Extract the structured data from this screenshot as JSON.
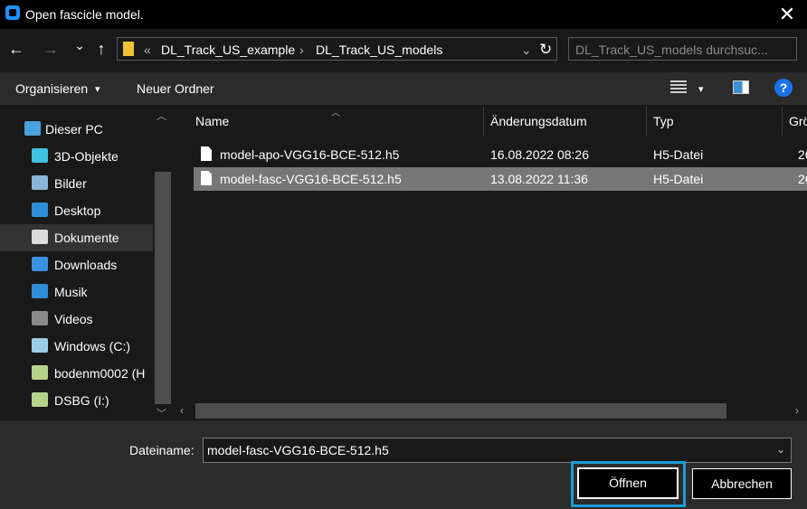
{
  "window": {
    "title": "Open fascicle model.",
    "close_glyph": "✕"
  },
  "nav": {
    "back_glyph": "←",
    "forward_glyph": "→",
    "recent_glyph": "⌄",
    "up_glyph": "↑",
    "breadcrumb_overflow": "«",
    "breadcrumb": [
      "DL_Track_US_example",
      "DL_Track_US_models"
    ],
    "separator": "›",
    "refresh_glyph": "↻",
    "search_placeholder": "DL_Track_US_models durchsuc..."
  },
  "toolbar": {
    "organize_label": "Organisieren",
    "organize_caret": "▾",
    "new_folder_label": "Neuer Ordner",
    "help_glyph": "?"
  },
  "sidebar": {
    "items": [
      {
        "label": "Dieser PC",
        "icon": "pc-icon"
      },
      {
        "label": "3D-Objekte",
        "icon": "cube-icon"
      },
      {
        "label": "Bilder",
        "icon": "pictures-icon"
      },
      {
        "label": "Desktop",
        "icon": "desktop-icon"
      },
      {
        "label": "Dokumente",
        "icon": "documents-icon"
      },
      {
        "label": "Downloads",
        "icon": "download-icon"
      },
      {
        "label": "Musik",
        "icon": "music-icon"
      },
      {
        "label": "Videos",
        "icon": "videos-icon"
      },
      {
        "label": "Windows (C:)",
        "icon": "drive-icon"
      },
      {
        "label": "bodenm0002 (H",
        "icon": "network-drive-icon"
      },
      {
        "label": "DSBG (I:)",
        "icon": "network-drive-icon"
      }
    ],
    "selected_index": 4
  },
  "list": {
    "columns": [
      "Name",
      "Änderungsdatum",
      "Typ",
      "Grö"
    ],
    "rows": [
      {
        "name": "model-apo-VGG16-BCE-512.h5",
        "date": "16.08.2022 08:26",
        "type": "H5-Datei",
        "size": "26"
      },
      {
        "name": "model-fasc-VGG16-BCE-512.h5",
        "date": "13.08.2022 11:36",
        "type": "H5-Datei",
        "size": "26"
      }
    ],
    "selected_index": 1
  },
  "footer": {
    "filename_label": "Dateiname:",
    "filename_value": "model-fasc-VGG16-BCE-512.h5",
    "open_label": "Öffnen",
    "cancel_label": "Abbrechen"
  },
  "colors": {
    "accent": "#1d9ad6",
    "selection": "#777777",
    "sidebar_selected": "#333333"
  }
}
